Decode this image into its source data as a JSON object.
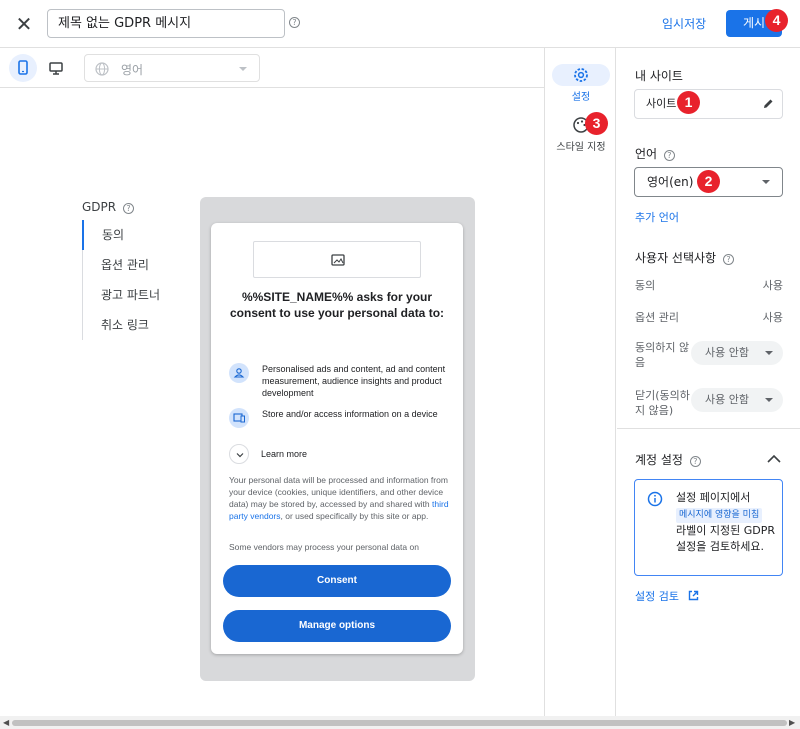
{
  "header": {
    "title_value": "제목 없는 GDPR 메시지",
    "save_draft_label": "임시저장",
    "publish_label": "게시"
  },
  "toolbar": {
    "language_placeholder": "영어"
  },
  "message_nav": {
    "title": "GDPR",
    "items": [
      "동의",
      "옵션 관리",
      "광고 파트너",
      "취소 링크"
    ]
  },
  "preview": {
    "title": "%%SITE_NAME%% asks for your consent to use your personal data to:",
    "purposes": [
      "Personalised ads and content, ad and content measurement, audience insights and product development",
      "Store and/or access information on a device"
    ],
    "learn_more": "Learn more",
    "body_before_link": "Your personal data will be processed and information from your device (cookies, unique identifiers, and other device data) may be stored by, accessed by and shared with ",
    "body_link": "third party vendors",
    "body_after_link": ", or used specifically by this site or app.",
    "body2": "Some vendors may process your personal data on",
    "consent_button": "Consent",
    "manage_button": "Manage options"
  },
  "rail": {
    "settings_label": "설정",
    "style_label": "스타일 지정"
  },
  "panel": {
    "my_site_heading": "내 사이트",
    "site_value": "사이트",
    "language_heading": "언어",
    "language_value": "영어(en)",
    "add_language": "추가 언어",
    "user_choices_heading": "사용자 선택사항",
    "choices": [
      {
        "label": "동의",
        "value": "사용"
      },
      {
        "label": "옵션 관리",
        "value": "사용"
      }
    ],
    "do_not_consent_label": "동의하지 않음",
    "do_not_consent_value": "사용 안함",
    "close_label": "닫기(동의하지 않음)",
    "close_value": "사용 안함",
    "account_settings_heading": "계정 설정",
    "info_before": "설정 페이지에서",
    "info_chip": "메시지에 영향을 미침",
    "info_after": "라벨이 지정된 GDPR 설정을 검토하세요.",
    "review_link": "설정 검토"
  },
  "badges": [
    "1",
    "2",
    "3",
    "4"
  ],
  "colors": {
    "accent": "#1a73e8",
    "badge": "#e8222c",
    "button": "#1967d2"
  }
}
